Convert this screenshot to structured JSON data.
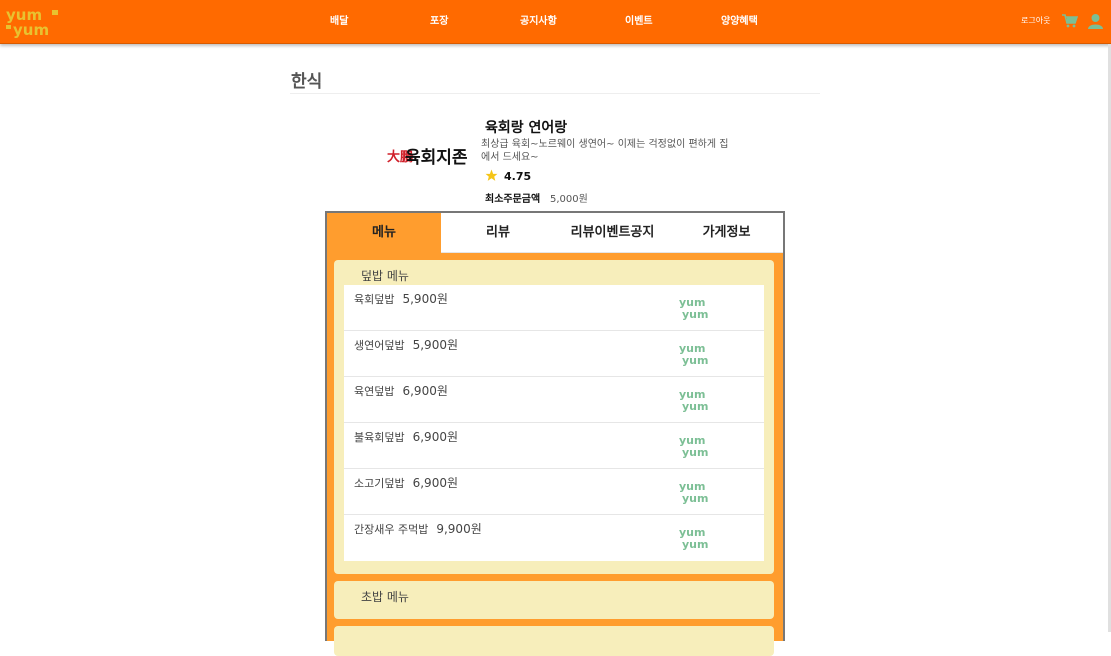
{
  "app": {
    "logo_text": "yum yum"
  },
  "nav": {
    "items": [
      "배달",
      "포장",
      "공지사항",
      "이벤트",
      "양양혜택"
    ],
    "logout": "로그아웃",
    "cart_icon": "cart-icon",
    "user_icon": "user-icon"
  },
  "page": {
    "category": "한식"
  },
  "store": {
    "name": "육회랑 연어랑",
    "description": "최상급 육회~노르웨이 생연어~ 이제는 걱정없이 편하게 집에서 드세요~",
    "rating": "4.75",
    "min_order_label": "최소주문금액",
    "min_order_value": "5,000원",
    "logo_text": "육회지존",
    "logo_badge": "大鵬"
  },
  "tabs": [
    "메뉴",
    "리뷰",
    "리뷰이벤트공지",
    "가게정보"
  ],
  "sections": [
    {
      "title": "덮밥 메뉴",
      "items": [
        {
          "name": "육회덮밥",
          "price": "5,900원"
        },
        {
          "name": "생연어덮밥",
          "price": "5,900원"
        },
        {
          "name": "육연덮밥",
          "price": "6,900원"
        },
        {
          "name": "불육회덮밥",
          "price": "6,900원"
        },
        {
          "name": "소고기덮밥",
          "price": "6,900원"
        },
        {
          "name": "간장새우 주먹밥",
          "price": "9,900원"
        }
      ]
    },
    {
      "title": "초밥 메뉴",
      "items": []
    }
  ],
  "colors": {
    "header": "#ff6a00",
    "panel": "#ff9d2e",
    "section": "#f7eebb",
    "logo_green": "#7cbf95",
    "logo_yellow": "#e8c230"
  }
}
